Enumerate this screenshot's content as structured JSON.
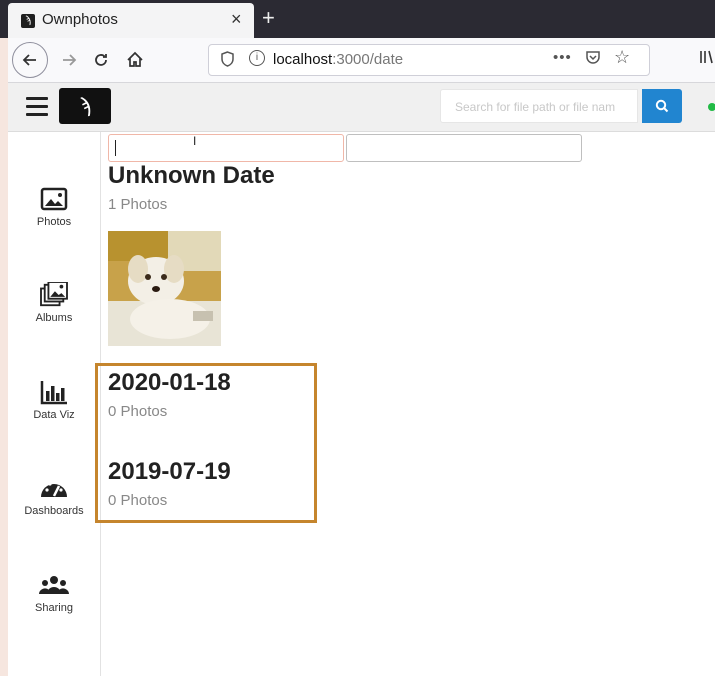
{
  "browser": {
    "tab_title": "Ownphotos",
    "tab_close": "×",
    "new_tab": "+",
    "url_host": "localhost",
    "url_path": ":3000/date",
    "more_actions": "•••"
  },
  "header": {
    "search_placeholder": "Search for file path or file nam",
    "accent_color": "#2185d0"
  },
  "sidebar": {
    "items": [
      {
        "label": "Photos",
        "icon": "photo-icon"
      },
      {
        "label": "Albums",
        "icon": "albums-icon"
      },
      {
        "label": "Data Viz",
        "icon": "bar-chart-icon"
      },
      {
        "label": "Dashboards",
        "icon": "dashboard-icon"
      },
      {
        "label": "Sharing",
        "icon": "users-icon"
      }
    ]
  },
  "main": {
    "groups": [
      {
        "title": "Unknown Date",
        "count": "1 Photos"
      },
      {
        "title": "2020-01-18",
        "count": "0 Photos"
      },
      {
        "title": "2019-07-19",
        "count": "0 Photos"
      }
    ],
    "highlight_color": "#c5852d"
  }
}
